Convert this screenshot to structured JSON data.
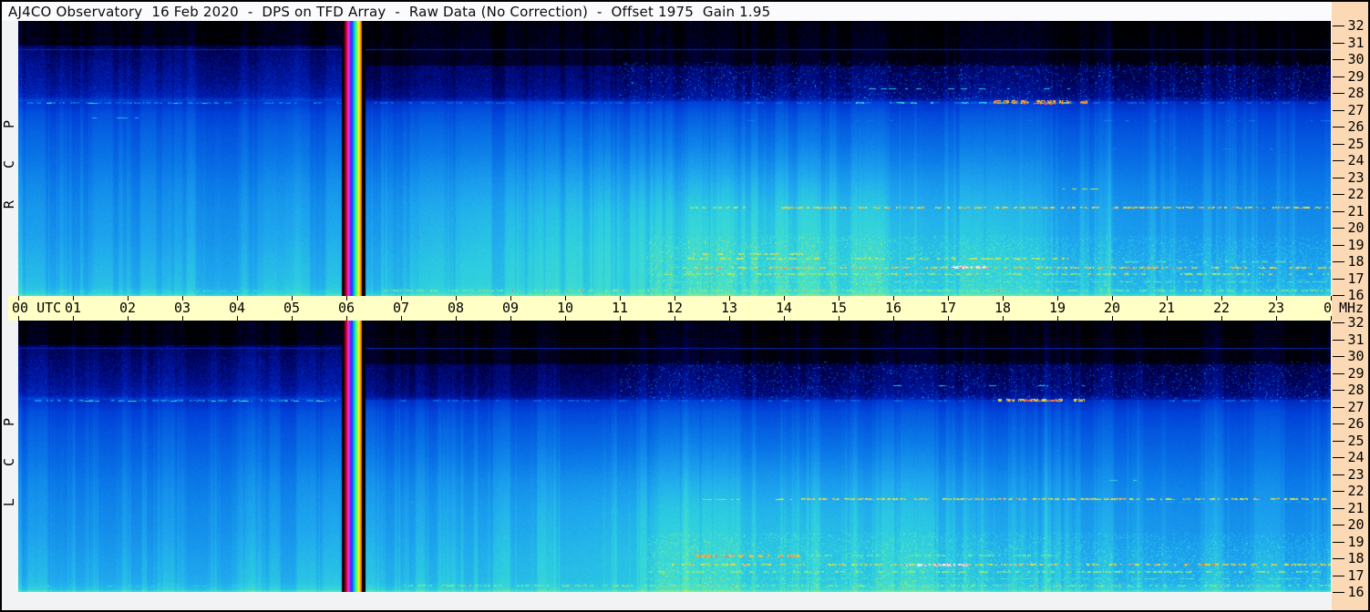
{
  "window": {
    "title": "AJ4CO Observatory  16 Feb 2020  -  DPS on TFD Array  -  Raw Data (No Correction)  -  Offset 1975  Gain 1.95"
  },
  "layout_colors": {
    "border": "#000000",
    "margin_bg": "#f2f3f5",
    "title_bg": "#fbfbfd",
    "time_axis_bg": "#ffffc6",
    "freq_axis_bg": "#fbd9b5",
    "axis_text": "#000000"
  },
  "time_axis": {
    "hours": [
      "00",
      "01",
      "02",
      "03",
      "04",
      "05",
      "06",
      "07",
      "08",
      "09",
      "10",
      "11",
      "12",
      "13",
      "14",
      "15",
      "16",
      "17",
      "18",
      "19",
      "20",
      "21",
      "22",
      "23",
      "00"
    ],
    "start_suffix": "UTC",
    "end_suffix": "MHz"
  },
  "freq_axis": {
    "ticks": [
      32,
      31,
      30,
      29,
      28,
      27,
      26,
      25,
      24,
      23,
      22,
      21,
      20,
      19,
      18,
      17,
      16
    ],
    "unit": "MHz"
  },
  "panels": [
    {
      "id": "rcp",
      "label": "R C P"
    },
    {
      "id": "lcp",
      "label": "L C P"
    }
  ],
  "chart_data": {
    "type": "heatmap",
    "title": "AJ4CO Observatory 16 Feb 2020 - DPS on TFD Array - Raw Data (No Correction) - Offset 1975 Gain 1.95",
    "xlabel": "UTC",
    "ylabel": "MHz",
    "x_range": [
      0,
      24
    ],
    "y_range": [
      16,
      32
    ],
    "x_ticks": [
      "00",
      "01",
      "02",
      "03",
      "04",
      "05",
      "06",
      "07",
      "08",
      "09",
      "10",
      "11",
      "12",
      "13",
      "14",
      "15",
      "16",
      "17",
      "18",
      "19",
      "20",
      "21",
      "22",
      "23",
      "00"
    ],
    "y_ticks": [
      32,
      31,
      30,
      29,
      28,
      27,
      26,
      25,
      24,
      23,
      22,
      21,
      20,
      19,
      18,
      17,
      16
    ],
    "grid": false,
    "legend": "none",
    "colormap": [
      [
        0.0,
        "#000000"
      ],
      [
        0.1,
        "#000050"
      ],
      [
        0.22,
        "#0018a8"
      ],
      [
        0.35,
        "#0040d8"
      ],
      [
        0.5,
        "#0a78e8"
      ],
      [
        0.62,
        "#1fa8ee"
      ],
      [
        0.7,
        "#2ecfe0"
      ],
      [
        0.78,
        "#52e8c0"
      ],
      [
        0.84,
        "#9aec6a"
      ],
      [
        0.89,
        "#e8e84a"
      ],
      [
        0.94,
        "#ffa028"
      ],
      [
        0.975,
        "#ff4f30"
      ],
      [
        1.0,
        "#ff3fae"
      ]
    ],
    "background_profile": [
      [
        32,
        0.02
      ],
      [
        31,
        0.05
      ],
      [
        30.4,
        0.1
      ],
      [
        29.5,
        0.13
      ],
      [
        28.4,
        0.16
      ],
      [
        27.6,
        0.2
      ],
      [
        27.3,
        0.3
      ],
      [
        26.6,
        0.37
      ],
      [
        25.5,
        0.42
      ],
      [
        24,
        0.47
      ],
      [
        22.5,
        0.52
      ],
      [
        21,
        0.555
      ],
      [
        19.5,
        0.58
      ],
      [
        18,
        0.615
      ],
      [
        17,
        0.635
      ],
      [
        16.5,
        0.65
      ],
      [
        16,
        0.7
      ]
    ],
    "dark_top_mhz_before_cal": 30.55,
    "dark_top_mhz_after_cal": 29.4,
    "cal_stripe": {
      "t_start": 5.95,
      "t_end": 6.28,
      "gap_t_end": 6.35,
      "colors": [
        "#3c0000",
        "#900018",
        "#e00060",
        "#ff30c0",
        "#b030ff",
        "#5828ff",
        "#1040ff",
        "#00a0ff",
        "#00e0cc",
        "#30ff70",
        "#b0ff30",
        "#ffff20",
        "#ffb010",
        "#ff5010"
      ]
    },
    "day_glow": {
      "t_center": 13.6,
      "t_sigma": 4.3,
      "f_center": 20.3,
      "f_sigma": 3.8
    },
    "panels": [
      {
        "name": "RCP",
        "seed": 12345,
        "glow_amp": 0.13,
        "light_columns": [
          {
            "t": 18.3,
            "amp": 0.05,
            "w": 2
          },
          {
            "t": 19.95,
            "amp": 0.05,
            "w": 2
          },
          {
            "t": 22.1,
            "amp": 0.035,
            "w": 2
          },
          {
            "t": 3.2,
            "amp": 0.02,
            "w": 6
          },
          {
            "t": 5.1,
            "amp": 0.025,
            "w": 3
          }
        ],
        "rfi_lines": [
          {
            "f": 30.35,
            "t0": 0,
            "t1": 24,
            "v": 0.27,
            "density": 1,
            "h": 1
          },
          {
            "f": 27.25,
            "t0": 0.15,
            "t1": 5.95,
            "v": 0.5,
            "density": 0.45,
            "h": 2
          },
          {
            "f": 27.25,
            "t0": 0.5,
            "t1": 5.5,
            "v": 0.72,
            "density": 0.06,
            "h": 1
          },
          {
            "f": 27.25,
            "t0": 6.4,
            "t1": 24,
            "v": 0.45,
            "density": 0.22,
            "h": 2
          },
          {
            "f": 27.25,
            "t0": 14.8,
            "t1": 19.6,
            "v": 0.72,
            "density": 0.18,
            "h": 2
          },
          {
            "f": 27.3,
            "t0": 17.75,
            "t1": 19.55,
            "v": 0.93,
            "density": 0.7,
            "h": 4,
            "magenta": 0.06
          },
          {
            "f": 27.2,
            "t0": 18.35,
            "t1": 19.1,
            "v": 0.985,
            "density": 0.6,
            "h": 2
          },
          {
            "f": 28.1,
            "t0": 15.3,
            "t1": 19.6,
            "v": 0.7,
            "density": 0.1,
            "h": 1
          },
          {
            "f": 28.8,
            "t0": 17.5,
            "t1": 21.5,
            "v": 0.66,
            "density": 0.07,
            "h": 1
          },
          {
            "f": 26.4,
            "t0": 1.2,
            "t1": 2.2,
            "v": 0.66,
            "density": 0.2,
            "h": 1
          },
          {
            "f": 26.2,
            "t0": 12,
            "t1": 24,
            "v": 0.5,
            "density": 0.06,
            "h": 1
          },
          {
            "f": 24.6,
            "t0": 12,
            "t1": 24,
            "v": 0.52,
            "density": 0.05,
            "h": 1
          },
          {
            "f": 22.25,
            "t0": 19.1,
            "t1": 19.8,
            "v": 0.85,
            "density": 0.5,
            "h": 1
          },
          {
            "f": 21.45,
            "t0": 7,
            "t1": 24,
            "v": 0.6,
            "density": 0.35,
            "h": 1
          },
          {
            "f": 21.15,
            "t0": 13.95,
            "t1": 24,
            "v": 0.9,
            "density": 0.8,
            "h": 2,
            "magenta": 0.04
          },
          {
            "f": 21.15,
            "t0": 12.25,
            "t1": 13.3,
            "v": 0.85,
            "density": 0.5,
            "h": 2
          },
          {
            "f": 19.25,
            "t0": 7,
            "t1": 24,
            "v": 0.6,
            "density": 0.3,
            "h": 1
          },
          {
            "f": 18.45,
            "t0": 12.3,
            "t1": 14.6,
            "v": 0.88,
            "density": 0.5,
            "h": 2
          },
          {
            "f": 18.15,
            "t0": 12.2,
            "t1": 19.2,
            "v": 0.86,
            "density": 0.45,
            "h": 2
          },
          {
            "f": 18.0,
            "t0": 19.5,
            "t1": 24,
            "v": 0.8,
            "density": 0.25,
            "h": 1
          },
          {
            "f": 17.65,
            "t0": 11.9,
            "t1": 24,
            "v": 0.9,
            "density": 0.6,
            "h": 2,
            "magenta": 0.05
          },
          {
            "f": 17.7,
            "t0": 17.0,
            "t1": 17.85,
            "v": 1,
            "density": 0.85,
            "h": 3,
            "color": "#ffffff",
            "magenta": 0.15
          },
          {
            "f": 17.65,
            "t0": 20.2,
            "t1": 20.85,
            "v": 0.94,
            "density": 0.8,
            "h": 2
          },
          {
            "f": 17.25,
            "t0": 11.5,
            "t1": 24,
            "v": 0.84,
            "density": 0.5,
            "h": 2,
            "magenta": 0.03
          },
          {
            "f": 16.85,
            "t0": 12,
            "t1": 24,
            "v": 0.78,
            "density": 0.3,
            "h": 1
          },
          {
            "f": 16.3,
            "t0": 6.6,
            "t1": 24,
            "v": 0.8,
            "density": 0.45,
            "h": 2,
            "magenta": 0.04
          },
          {
            "f": 16.3,
            "t0": 0.2,
            "t1": 5.9,
            "v": 0.72,
            "density": 0.25,
            "h": 1
          }
        ]
      },
      {
        "name": "LCP",
        "seed": 67890,
        "glow_amp": 0.11,
        "light_columns": [
          {
            "t": 18.8,
            "amp": 0.05,
            "w": 2
          },
          {
            "t": 12.2,
            "amp": 0.04,
            "w": 2
          },
          {
            "t": 21.9,
            "amp": 0.03,
            "w": 2
          },
          {
            "t": 4.3,
            "amp": 0.02,
            "w": 5
          }
        ],
        "rfi_lines": [
          {
            "f": 30.4,
            "t0": 0,
            "t1": 24,
            "v": 0.27,
            "density": 1,
            "h": 1
          },
          {
            "f": 27.3,
            "t0": 0.2,
            "t1": 5.9,
            "v": 0.55,
            "density": 0.4,
            "h": 2
          },
          {
            "f": 27.3,
            "t0": 0.5,
            "t1": 5.8,
            "v": 0.74,
            "density": 0.08,
            "h": 1
          },
          {
            "f": 27.3,
            "t0": 6.4,
            "t1": 24,
            "v": 0.45,
            "density": 0.2,
            "h": 2
          },
          {
            "f": 27.35,
            "t0": 17.9,
            "t1": 19.5,
            "v": 0.9,
            "density": 0.55,
            "h": 3,
            "magenta": 0.05
          },
          {
            "f": 27.3,
            "t0": 18.4,
            "t1": 19.1,
            "v": 0.97,
            "density": 0.4,
            "h": 2
          },
          {
            "f": 28.2,
            "t0": 16,
            "t1": 19.5,
            "v": 0.66,
            "density": 0.06,
            "h": 1
          },
          {
            "f": 22.6,
            "t0": 19.9,
            "t1": 20.6,
            "v": 0.72,
            "density": 0.3,
            "h": 1
          },
          {
            "f": 21.5,
            "t0": 13.85,
            "t1": 24,
            "v": 0.88,
            "density": 0.7,
            "h": 2,
            "magenta": 0.04
          },
          {
            "f": 21.5,
            "t0": 12.3,
            "t1": 13.2,
            "v": 0.8,
            "density": 0.4,
            "h": 1
          },
          {
            "f": 21.3,
            "t0": 7,
            "t1": 24,
            "v": 0.6,
            "density": 0.3,
            "h": 1
          },
          {
            "f": 19.3,
            "t0": 7,
            "t1": 24,
            "v": 0.58,
            "density": 0.25,
            "h": 1
          },
          {
            "f": 18.15,
            "t0": 12.35,
            "t1": 14.3,
            "v": 0.92,
            "density": 0.75,
            "h": 3,
            "magenta": 0.06
          },
          {
            "f": 18.15,
            "t0": 14.5,
            "t1": 19,
            "v": 0.8,
            "density": 0.3,
            "h": 2
          },
          {
            "f": 17.6,
            "t0": 11.8,
            "t1": 24,
            "v": 0.88,
            "density": 0.55,
            "h": 2,
            "magenta": 0.05
          },
          {
            "f": 17.6,
            "t0": 16.2,
            "t1": 17.35,
            "v": 1,
            "density": 0.85,
            "h": 3,
            "color": "#f0f0ff",
            "magenta": 0.2
          },
          {
            "f": 17.6,
            "t0": 21.3,
            "t1": 21.9,
            "v": 0.95,
            "density": 0.7,
            "h": 2,
            "magenta": 0.1
          },
          {
            "f": 17.2,
            "t0": 11.5,
            "t1": 24,
            "v": 0.82,
            "density": 0.45,
            "h": 2
          },
          {
            "f": 16.8,
            "t0": 12,
            "t1": 24,
            "v": 0.76,
            "density": 0.3,
            "h": 1
          },
          {
            "f": 16.4,
            "t0": 7,
            "t1": 24,
            "v": 0.8,
            "density": 0.5,
            "h": 2,
            "magenta": 0.04
          },
          {
            "f": 16.4,
            "t0": 0.2,
            "t1": 5.9,
            "v": 0.7,
            "density": 0.2,
            "h": 1
          }
        ]
      }
    ]
  }
}
